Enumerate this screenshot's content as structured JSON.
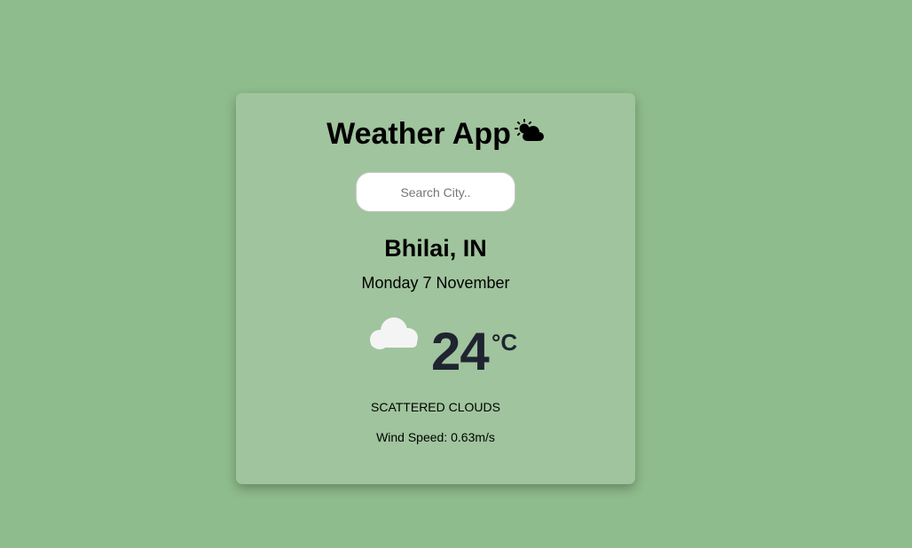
{
  "app": {
    "title": "Weather App",
    "title_icon": "sun-behind-cloud-icon"
  },
  "search": {
    "placeholder": "Search City..",
    "value": ""
  },
  "weather": {
    "location": "Bhilai, IN",
    "date": "Monday 7 November",
    "condition_icon": "cloud-icon",
    "temperature": "24",
    "unit": "°C",
    "description": "SCATTERED CLOUDS",
    "wind": "Wind Speed: 0.63m/s"
  },
  "colors": {
    "background": "#8fbc8c",
    "card": "#a0c49d",
    "temperature_text": "#1f2430",
    "cloud": "#f4f4f4"
  }
}
